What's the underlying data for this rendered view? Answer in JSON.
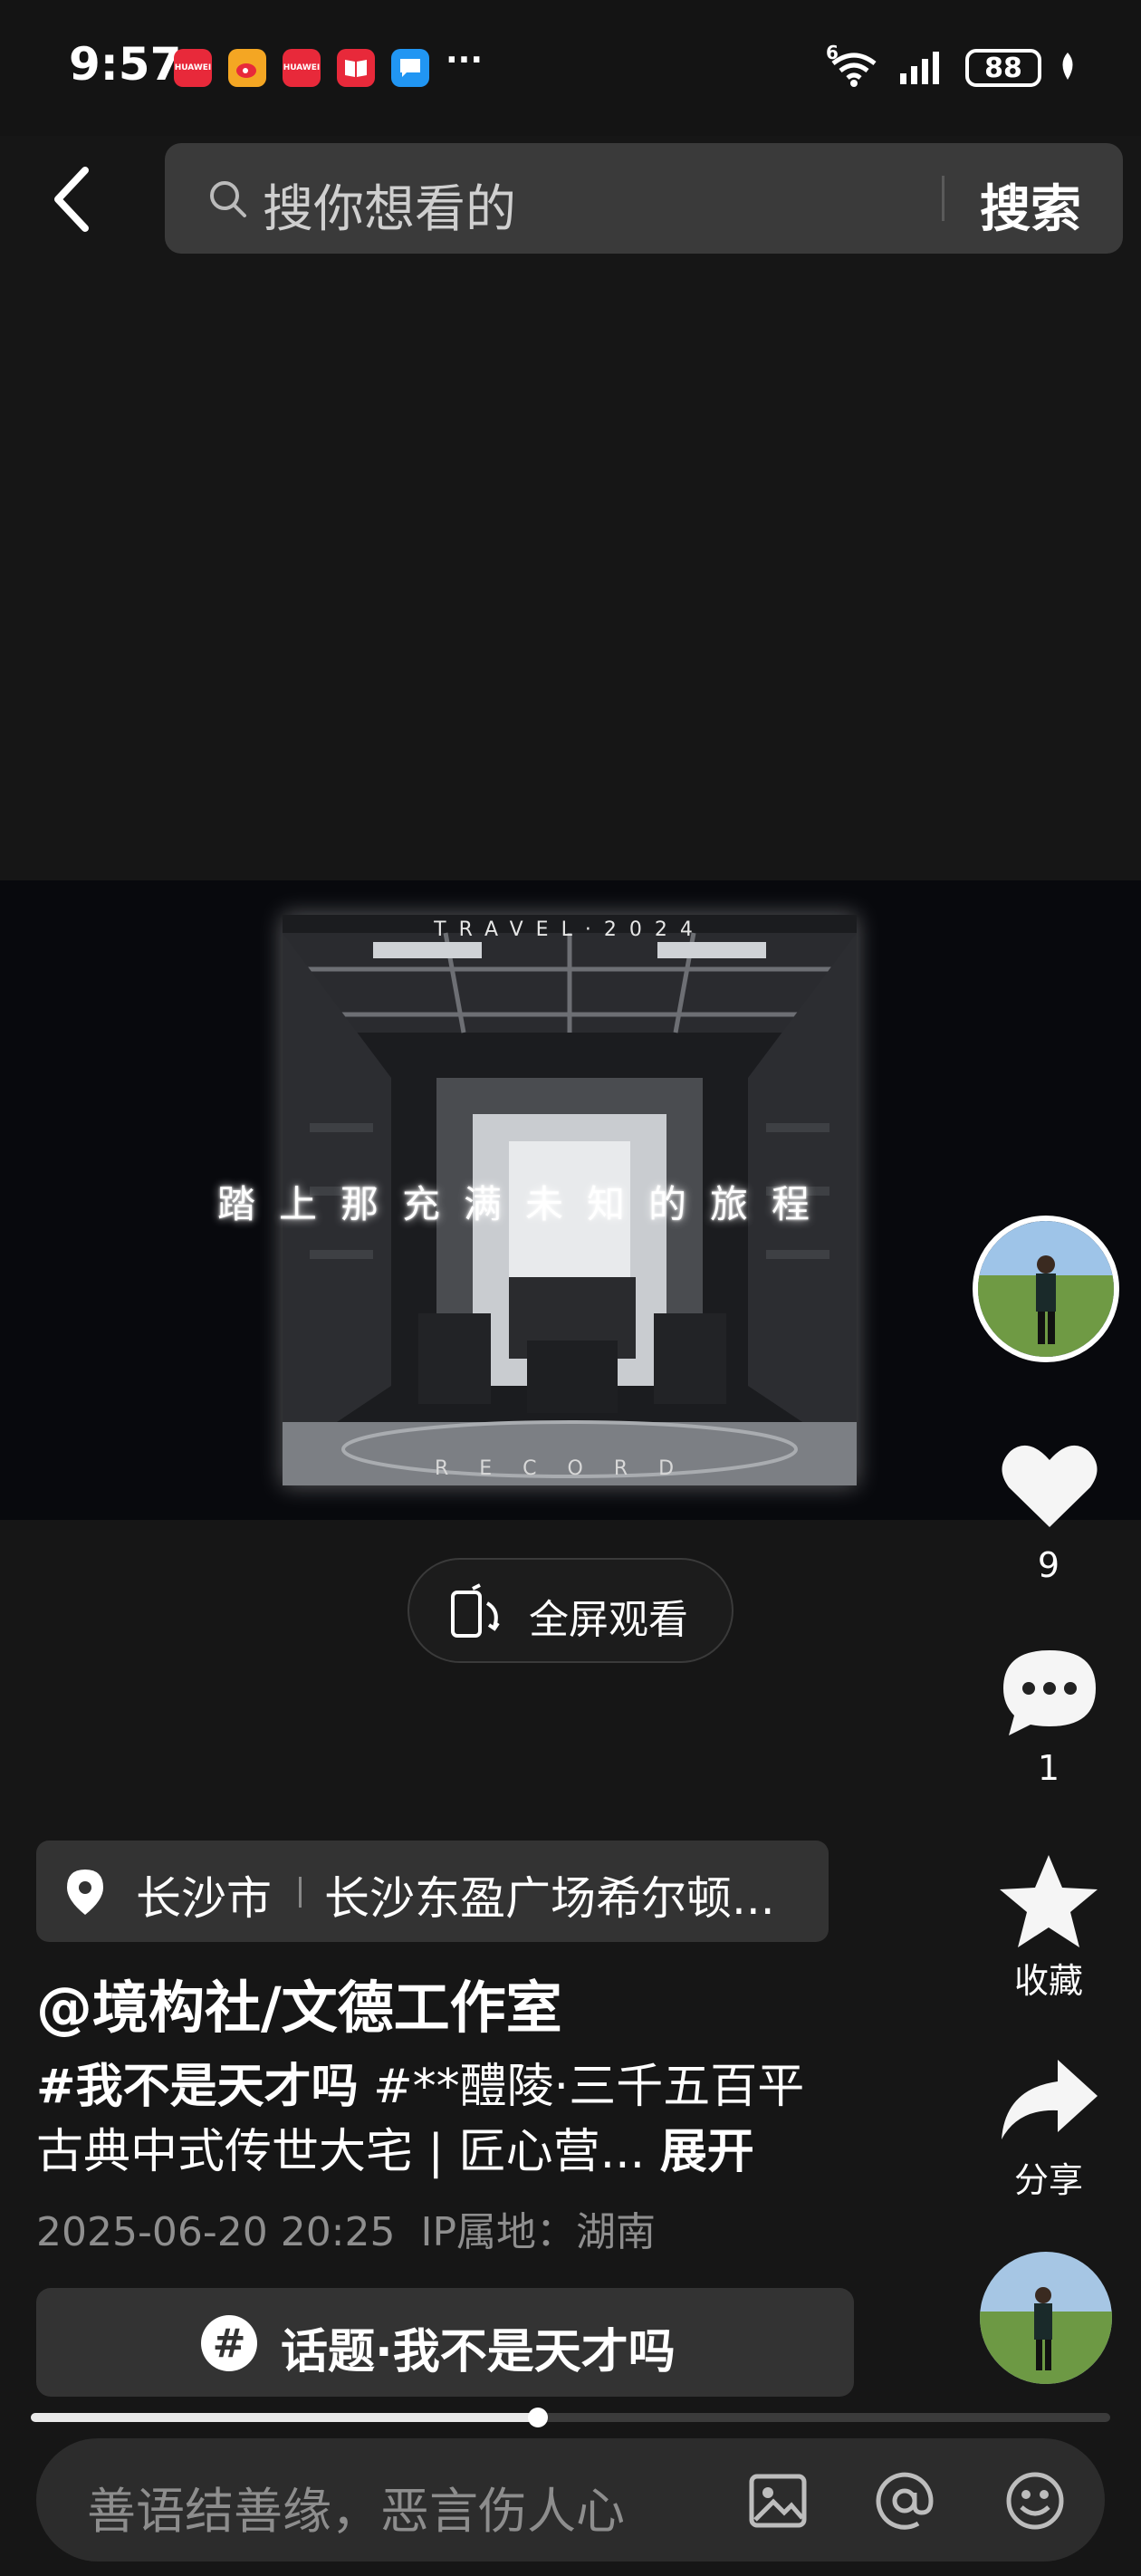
{
  "status_bar": {
    "time": "9:57",
    "app_icons": [
      {
        "name": "huawei-appgallery-icon",
        "label": "HUAWEI",
        "color": "#e8293a"
      },
      {
        "name": "weibo-icon",
        "label": "",
        "color": "#f4a623"
      },
      {
        "name": "huawei-appgallery-icon",
        "label": "HUAWEI",
        "color": "#e8293a"
      },
      {
        "name": "book-app-icon",
        "label": "",
        "color": "#e8293a"
      },
      {
        "name": "message-app-icon",
        "label": "",
        "color": "#2196f3"
      }
    ],
    "more": "···",
    "network": "6",
    "battery": "88"
  },
  "header": {
    "search_placeholder": "搜你想看的",
    "search_button": "搜索"
  },
  "video": {
    "top_text": "TRAVEL·2024",
    "caption": "踏上那充满未知的旅程",
    "bottom_text": "RECORD",
    "fullscreen_label": "全屏观看"
  },
  "rail": {
    "likes": "9",
    "comments": "1",
    "favorite_label": "收藏",
    "share_label": "分享"
  },
  "post": {
    "location_city": "长沙市",
    "location_place": "长沙东盈广场希尔顿...",
    "author": "@境构社/文德工作室",
    "tag1": "#我不是天才吗",
    "desc_line": " #**醴陵·三千五百平",
    "desc_line2": "古典中式传世大宅 | 匠心营...",
    "expand": "展开",
    "timestamp": "2025-06-20 20:25",
    "ip_location": "IP属地：湖南",
    "topic": "话题·我不是天才吗"
  },
  "progress": 0.47,
  "comment_bar": {
    "placeholder": "善语结善缘，恶言伤人心"
  }
}
